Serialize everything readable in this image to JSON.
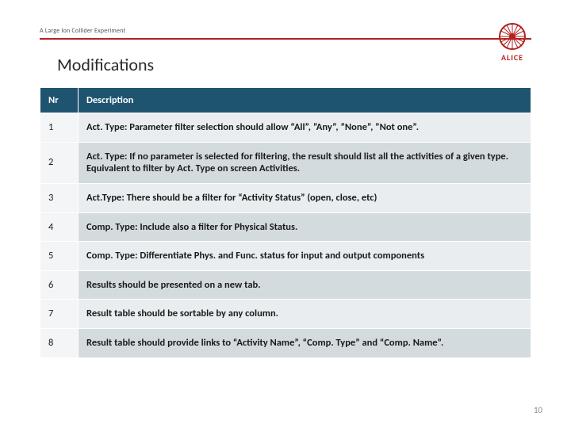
{
  "header": {
    "experiment_label": "A Large Ion Collider Experiment",
    "logo_text": "ALICE"
  },
  "title": "Modifications",
  "table": {
    "columns": {
      "nr": "Nr",
      "description": "Description"
    },
    "rows": [
      {
        "nr": "1",
        "description": "Act. Type: Parameter filter selection should allow “All”, ”Any”, ”None”, ”Not one”."
      },
      {
        "nr": "2",
        "description": "Act. Type: If no parameter is selected for filtering, the result should list all the activities of a given type. Equivalent to filter by Act. Type on screen Activities."
      },
      {
        "nr": "3",
        "description": "Act.Type: There should be a filter for “Activity Status” (open, close, etc)"
      },
      {
        "nr": "4",
        "description": "Comp. Type: Include also a filter for Physical Status."
      },
      {
        "nr": "5",
        "description": "Comp. Type: Differentiate Phys. and Func. status for input and output components"
      },
      {
        "nr": "6",
        "description": "Results should be presented on a new tab."
      },
      {
        "nr": "7",
        "description": "Result table should be sortable by any column."
      },
      {
        "nr": "8",
        "description": "Result table should provide links to “Activity Name”, “Comp. Type” and “Comp. Name”."
      }
    ]
  },
  "page_number": "10"
}
